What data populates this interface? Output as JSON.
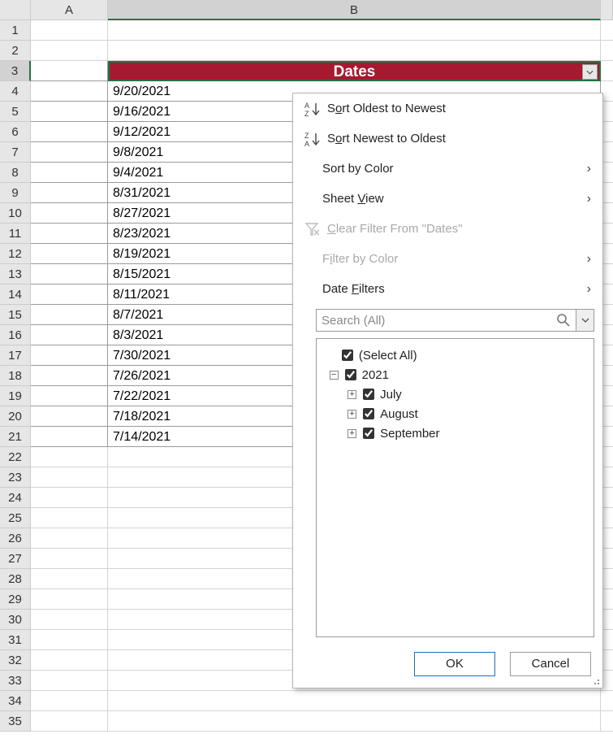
{
  "columns": {
    "A": "A",
    "B": "B"
  },
  "header_cell": "Dates",
  "dates": [
    "9/20/2021",
    "9/16/2021",
    "9/12/2021",
    "9/8/2021",
    "9/4/2021",
    "8/31/2021",
    "8/27/2021",
    "8/23/2021",
    "8/19/2021",
    "8/15/2021",
    "8/11/2021",
    "8/7/2021",
    "8/3/2021",
    "7/30/2021",
    "7/26/2021",
    "7/22/2021",
    "7/18/2021",
    "7/14/2021"
  ],
  "row_count_visible": 35,
  "dropdown": {
    "sort_asc_pre": "S",
    "sort_asc_mid": "o",
    "sort_asc_post": "rt Oldest to Newest",
    "sort_desc_pre": "S",
    "sort_desc_mid": "o",
    "sort_desc_post": "rt Newest to Oldest",
    "sort_by_color": "Sort by Color",
    "sheet_view_pre": "Sheet ",
    "sheet_view_mid": "V",
    "sheet_view_post": "iew",
    "clear_filter_pre": "",
    "clear_filter_mid": "C",
    "clear_filter_post": "lear Filter From \"Dates\"",
    "filter_by_color_pre": "F",
    "filter_by_color_mid": "i",
    "filter_by_color_post": "lter by Color",
    "date_filters_pre": "Date ",
    "date_filters_mid": "F",
    "date_filters_post": "ilters",
    "search_placeholder": "Search (All)",
    "tree": {
      "select_all": "(Select All)",
      "year": "2021",
      "months": [
        "July",
        "August",
        "September"
      ]
    },
    "ok": "OK",
    "cancel": "Cancel"
  }
}
